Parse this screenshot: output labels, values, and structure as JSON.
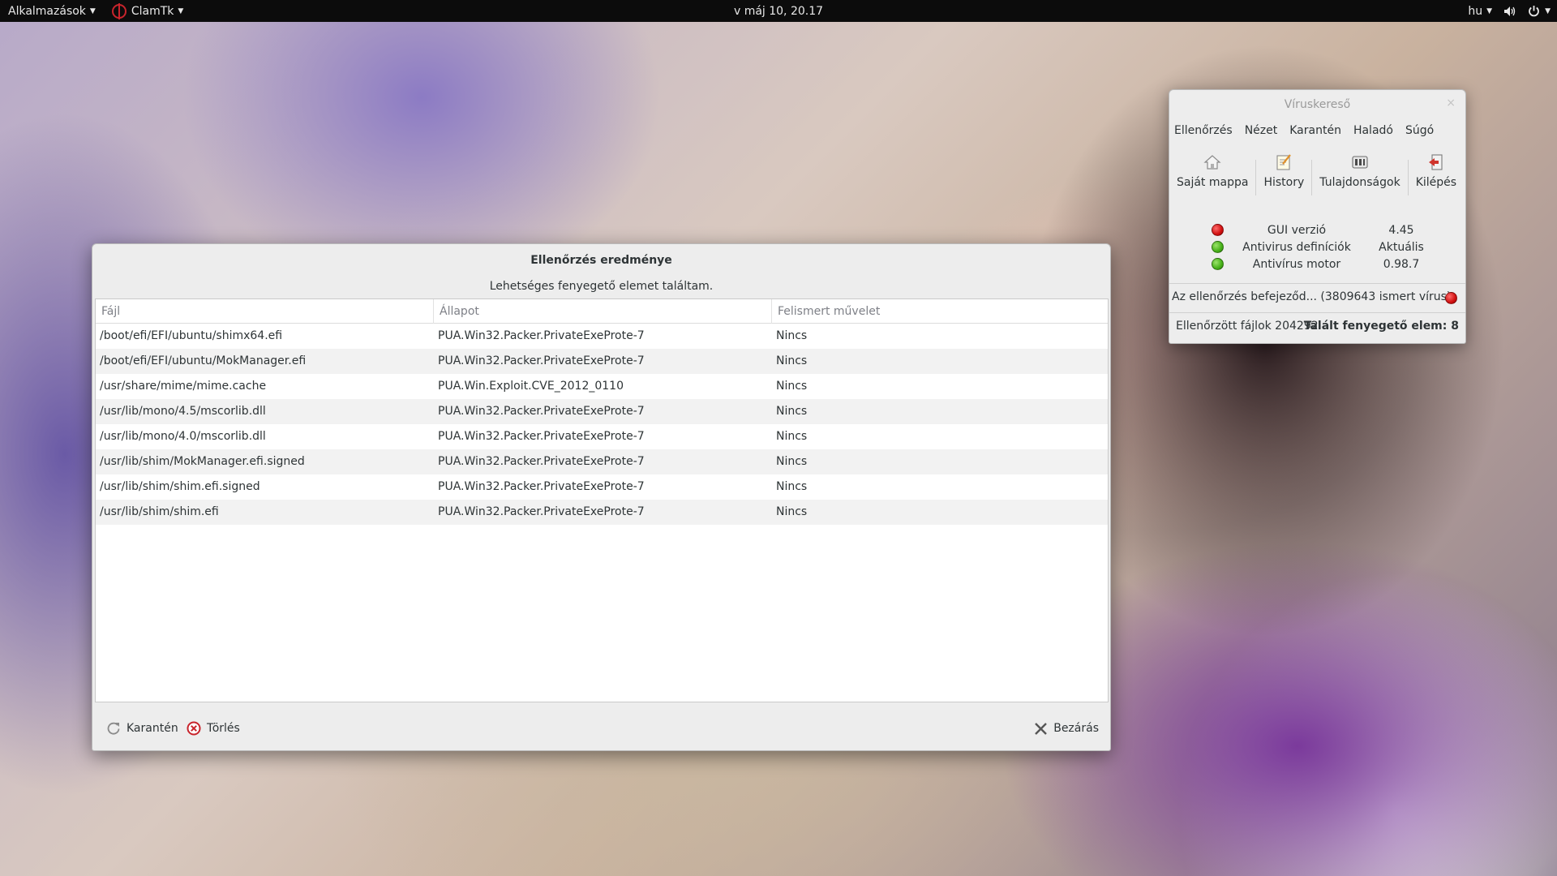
{
  "topbar": {
    "apps_label": "Alkalmazások",
    "app_name": "ClamTk",
    "clock": "v máj 10, 20.17",
    "lang": "hu"
  },
  "dialog": {
    "title": "Ellenőrzés eredménye",
    "subtitle": "Lehetséges fenyegető elemet találtam.",
    "columns": [
      "Fájl",
      "Állapot",
      "Felismert művelet"
    ],
    "rows": [
      [
        "/boot/efi/EFI/ubuntu/shimx64.efi",
        "PUA.Win32.Packer.PrivateExeProte-7",
        "Nincs"
      ],
      [
        "/boot/efi/EFI/ubuntu/MokManager.efi",
        "PUA.Win32.Packer.PrivateExeProte-7",
        "Nincs"
      ],
      [
        "/usr/share/mime/mime.cache",
        "PUA.Win.Exploit.CVE_2012_0110",
        "Nincs"
      ],
      [
        "/usr/lib/mono/4.5/mscorlib.dll",
        "PUA.Win32.Packer.PrivateExeProte-7",
        "Nincs"
      ],
      [
        "/usr/lib/mono/4.0/mscorlib.dll",
        "PUA.Win32.Packer.PrivateExeProte-7",
        "Nincs"
      ],
      [
        "/usr/lib/shim/MokManager.efi.signed",
        "PUA.Win32.Packer.PrivateExeProte-7",
        "Nincs"
      ],
      [
        "/usr/lib/shim/shim.efi.signed",
        "PUA.Win32.Packer.PrivateExeProte-7",
        "Nincs"
      ],
      [
        "/usr/lib/shim/shim.efi",
        "PUA.Win32.Packer.PrivateExeProte-7",
        "Nincs"
      ]
    ],
    "buttons": {
      "quarantine": "Karantén",
      "delete": "Törlés",
      "close": "Bezárás"
    }
  },
  "scanner": {
    "title": "Víruskereső",
    "close_glyph": "×",
    "menu": [
      "Ellenőrzés",
      "Nézet",
      "Karantén",
      "Haladó",
      "Súgó"
    ],
    "toolbar": [
      "Saját mappa",
      "History",
      "Tulajdonságok",
      "Kilépés"
    ],
    "status": [
      {
        "label": "GUI verzió",
        "value": "4.45",
        "color": "red"
      },
      {
        "label": "Antivirus definíciók",
        "value": "Aktuális",
        "color": "green"
      },
      {
        "label": "Antivírus motor",
        "value": "0.98.7",
        "color": "green"
      }
    ],
    "scan_status": "Az ellenőrzés befejeződ... (3809643 ismert vírus)",
    "files_checked": "Ellenőrzött fájlok 204292",
    "threats_found": "Talált fenyegető elem: 8"
  }
}
